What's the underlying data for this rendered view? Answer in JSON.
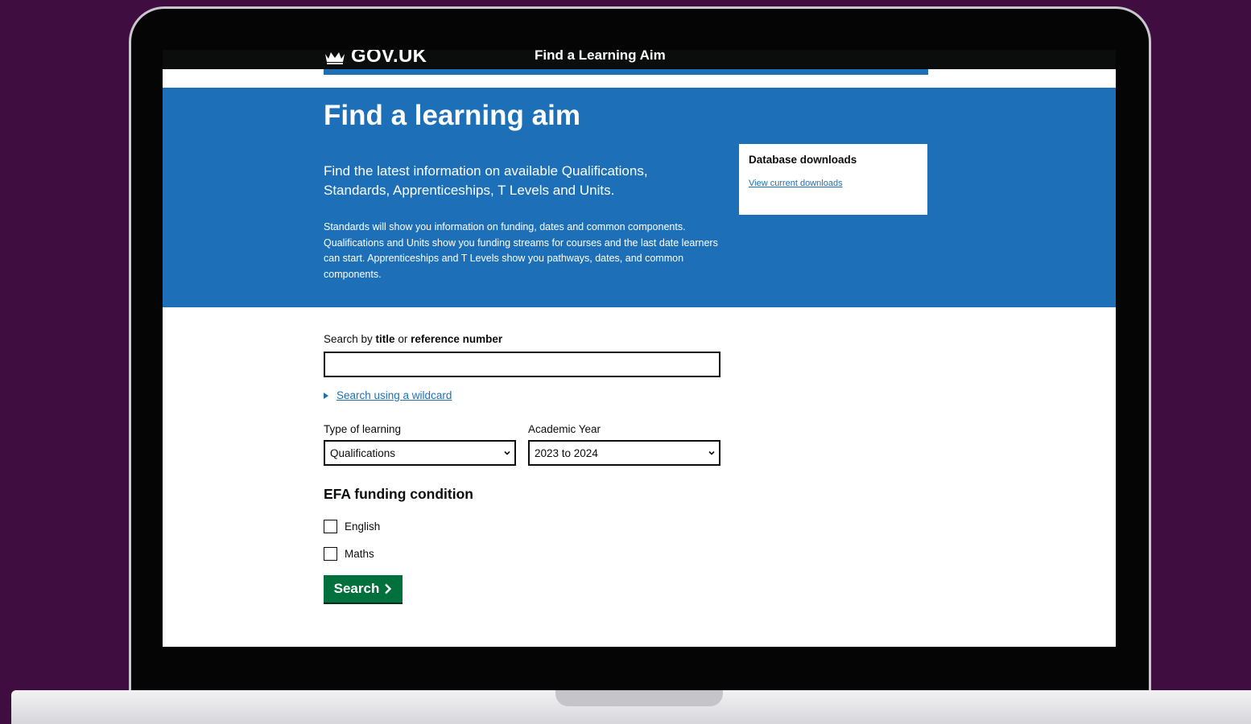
{
  "header": {
    "logo_text": "GOV.UK",
    "service_name": "Find a Learning Aim"
  },
  "hero": {
    "title": "Find a learning aim",
    "lead": "Find the latest information on available Qualifications, Standards, Apprenticeships, T Levels and Units.",
    "body": "Standards will show you information on funding, dates and common components. Qualifications and Units show you funding streams for courses and the last date learners can start. Apprenticeships and T Levels show you pathways, dates, and common components."
  },
  "downloads": {
    "title": "Database downloads",
    "link": "View current downloads"
  },
  "search": {
    "label_prefix": "Search by ",
    "label_title": "title",
    "label_middle": " or ",
    "label_reference": "reference number",
    "value": "",
    "wildcard_link": "Search using a wildcard"
  },
  "filters": {
    "type_label": "Type of learning",
    "type_value": "Qualifications",
    "year_label": "Academic Year",
    "year_value": "2023 to 2024"
  },
  "efa": {
    "heading": "EFA funding condition",
    "options": [
      {
        "label": "English",
        "checked": false
      },
      {
        "label": "Maths",
        "checked": false
      }
    ]
  },
  "button": {
    "label": "Search"
  },
  "colors": {
    "background": "#3f0d40",
    "govuk_blue": "#1d70b8",
    "govuk_black": "#0b0c0c",
    "button_green": "#00703c"
  },
  "icons": {
    "logo": "crown-icon",
    "details": "triangle-right-icon",
    "select": "chevron-down-icon",
    "button": "chevron-right-icon"
  }
}
